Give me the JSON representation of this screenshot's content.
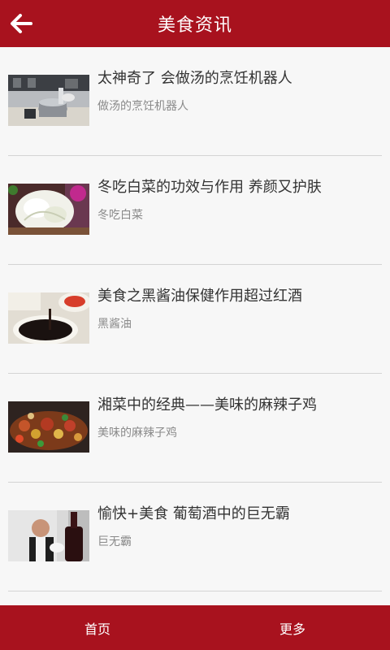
{
  "header": {
    "title": "美食资讯",
    "back_icon": "arrow-left-icon"
  },
  "articles": [
    {
      "title": "太神奇了 会做汤的烹饪机器人",
      "subtitle": "做汤的烹饪机器人",
      "thumb": "robot-cooking-photo"
    },
    {
      "title": "冬吃白菜的功效与作用 养颜又护肤",
      "subtitle": "冬吃白菜",
      "thumb": "cabbage-photo"
    },
    {
      "title": "美食之黑酱油保健作用超过红酒",
      "subtitle": "黑酱油",
      "thumb": "soy-sauce-photo"
    },
    {
      "title": "湘菜中的经典——美味的麻辣子鸡",
      "subtitle": "美味的麻辣子鸡",
      "thumb": "spicy-chicken-photo"
    },
    {
      "title": "愉快+美食 葡萄酒中的巨无霸",
      "subtitle": "巨无霸",
      "thumb": "wine-photo"
    }
  ],
  "footer": {
    "home_label": "首页",
    "more_label": "更多"
  },
  "colors": {
    "brand": "#a8121e",
    "background": "#f7f7f7"
  }
}
